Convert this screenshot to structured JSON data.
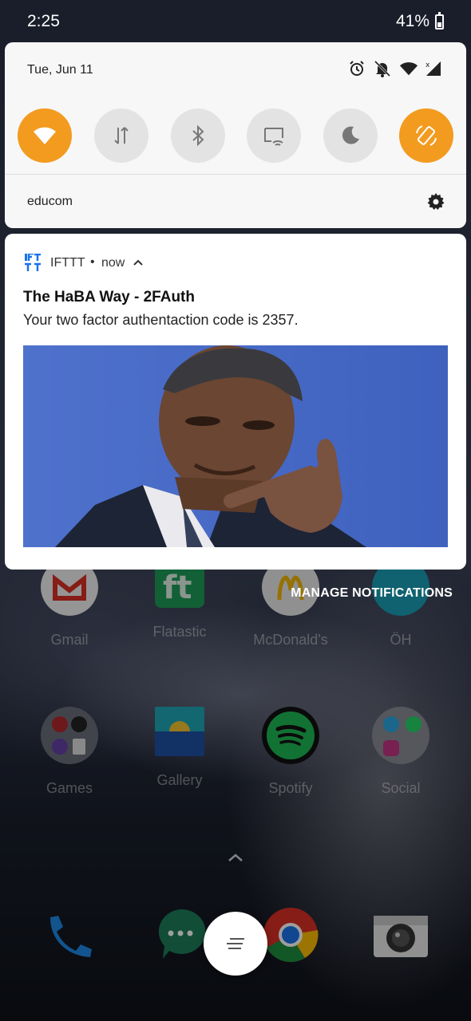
{
  "status_bar": {
    "time": "2:25",
    "battery": "41%"
  },
  "quick_settings": {
    "date": "Tue, Jun 11",
    "tiles": [
      {
        "name": "wifi",
        "active": true
      },
      {
        "name": "mobile-data",
        "active": false
      },
      {
        "name": "bluetooth",
        "active": false
      },
      {
        "name": "hotspot",
        "active": false
      },
      {
        "name": "night-mode",
        "active": false
      },
      {
        "name": "auto-rotate",
        "active": true
      }
    ],
    "network_name": "educom"
  },
  "notification": {
    "app_name": "IFTTT",
    "separator": "•",
    "time": "now",
    "title": "The HaBA Way - 2FAuth",
    "body": "Your two factor authentaction code is 2357."
  },
  "manage_notifications_label": "MANAGE NOTIFICATIONS",
  "home": {
    "row1": [
      {
        "label": "Gmail"
      },
      {
        "label": "Flatastic"
      },
      {
        "label": "McDonald's"
      },
      {
        "label": "ÖH"
      }
    ],
    "row2": [
      {
        "label": "Games"
      },
      {
        "label": "Gallery"
      },
      {
        "label": "Spotify"
      },
      {
        "label": "Social"
      }
    ]
  },
  "colors": {
    "accent": "#f29b1f",
    "tile_off": "#e3e3e3",
    "panel": "#f7f7f7"
  }
}
